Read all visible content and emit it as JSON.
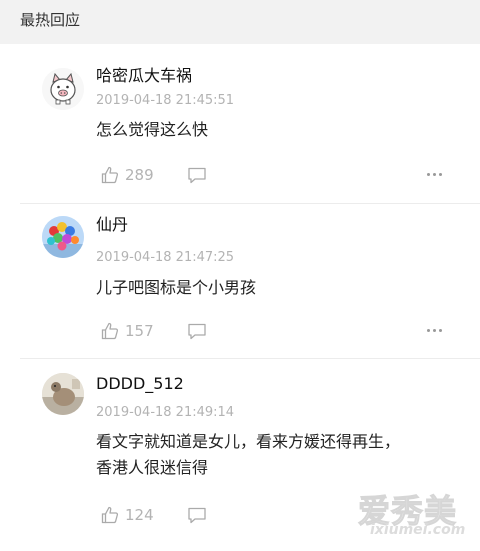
{
  "section": {
    "title": "最热回应"
  },
  "comments": [
    {
      "username": "哈密瓜大车祸",
      "time": "2019-04-18 21:45:51",
      "lines": [
        "怎么觉得这么快"
      ],
      "likes": "289",
      "avatar": "pig-avatar"
    },
    {
      "username": "仙丹",
      "time": "2019-04-18 21:47:25",
      "lines": [
        "儿子吧图标是个小男孩"
      ],
      "likes": "157",
      "avatar": "balloons-avatar"
    },
    {
      "username": "DDDD_512",
      "time": "2019-04-18 21:49:14",
      "lines": [
        "看文字就知道是女儿，看来方媛还得再生，",
        "香港人很迷信得"
      ],
      "likes": "124",
      "avatar": "photo-avatar"
    }
  ],
  "watermark": {
    "cn": "爱秀美",
    "en": "ixiumei.com"
  },
  "icons": {
    "like": "thumbs-up-icon",
    "reply": "speech-bubble-icon",
    "more": "more-dots-icon"
  },
  "colors": {
    "header_bg": "#f2f2f2",
    "meta_gray": "#b3b3b3",
    "text": "#222222"
  }
}
